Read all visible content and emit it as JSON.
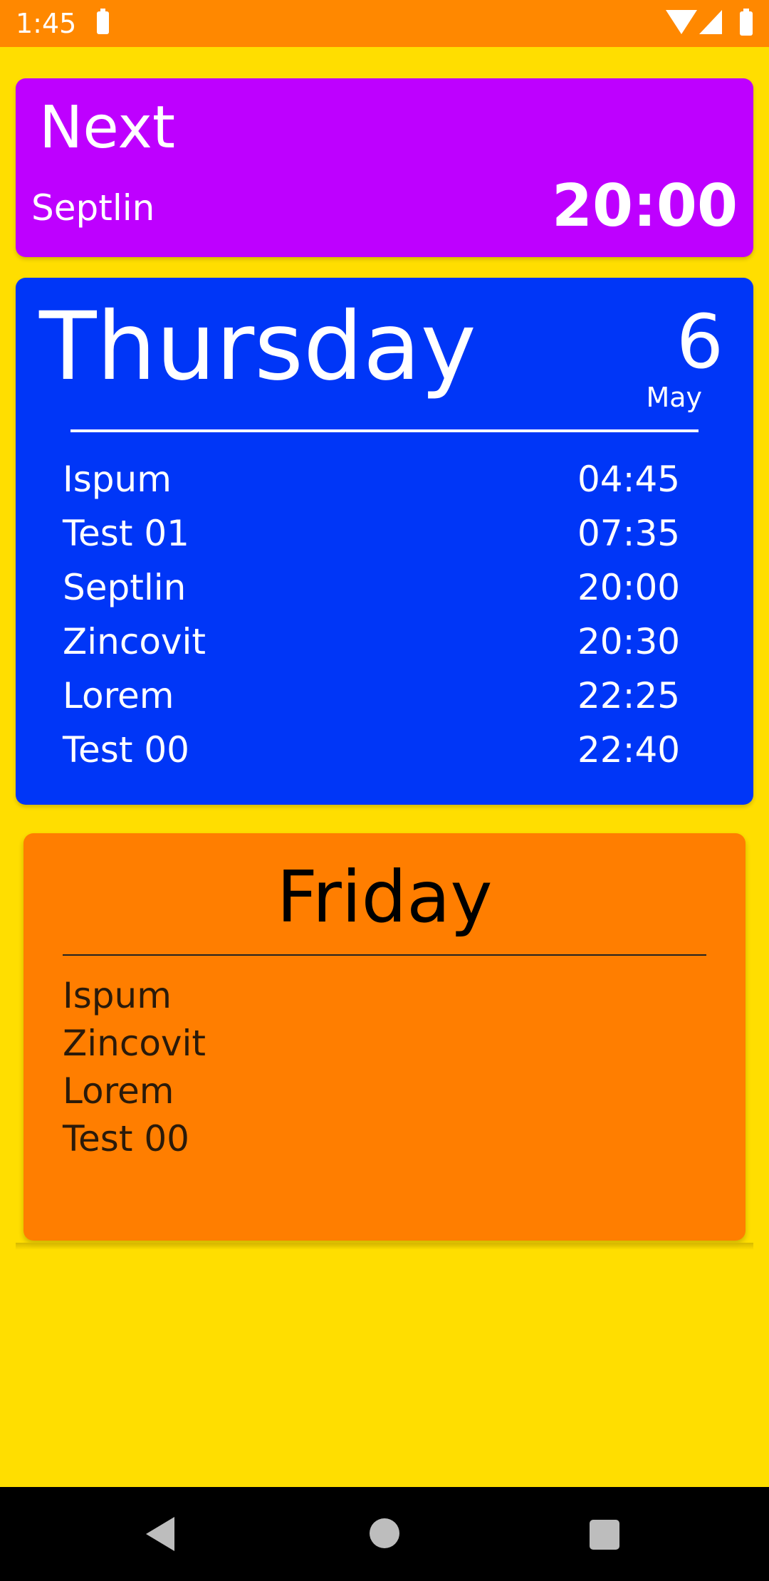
{
  "status_bar": {
    "time": "1:45"
  },
  "next_card": {
    "title": "Next",
    "name": "Septlin",
    "time": "20:00",
    "color": "#BE00FF"
  },
  "today_card": {
    "day": "Thursday",
    "date_number": "6",
    "date_month": "May",
    "color": "#0036F7",
    "items": [
      {
        "name": "Ispum",
        "time": "04:45"
      },
      {
        "name": "Test 01",
        "time": "07:35"
      },
      {
        "name": "Septlin",
        "time": "20:00"
      },
      {
        "name": "Zincovit",
        "time": "20:30"
      },
      {
        "name": "Lorem",
        "time": "22:25"
      },
      {
        "name": "Test 00",
        "time": "22:40"
      }
    ]
  },
  "next_day_card": {
    "day": "Friday",
    "color": "#FF7E00",
    "items": [
      "Ispum",
      "Zincovit",
      "Lorem",
      "Test 00"
    ]
  },
  "nav_bar": {
    "icons": [
      "back-icon",
      "home-icon",
      "recents-icon"
    ]
  }
}
